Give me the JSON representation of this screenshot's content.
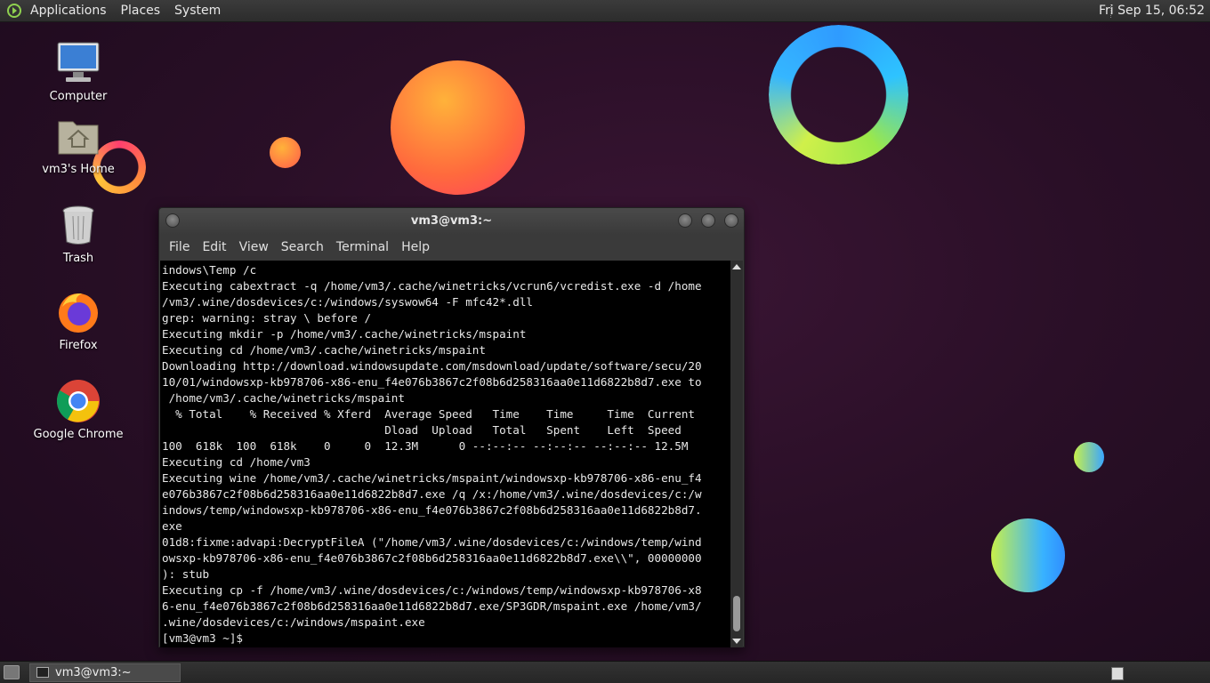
{
  "top_panel": {
    "menus": [
      "Applications",
      "Places",
      "System"
    ],
    "clock": "Fri Sep 15, 06:52"
  },
  "desktop_icons": [
    {
      "label": "Computer",
      "icon": "computer-icon"
    },
    {
      "label": "vm3's Home",
      "icon": "home-folder-icon"
    },
    {
      "label": "Trash",
      "icon": "trash-icon"
    },
    {
      "label": "Firefox",
      "icon": "firefox-icon"
    },
    {
      "label": "Google Chrome",
      "icon": "chrome-icon"
    }
  ],
  "window": {
    "title": "vm3@vm3:~",
    "menu": [
      "File",
      "Edit",
      "View",
      "Search",
      "Terminal",
      "Help"
    ],
    "lines": [
      "indows\\Temp /c",
      "Executing cabextract -q /home/vm3/.cache/winetricks/vcrun6/vcredist.exe -d /home",
      "/vm3/.wine/dosdevices/c:/windows/syswow64 -F mfc42*.dll",
      "grep: warning: stray \\ before /",
      "Executing mkdir -p /home/vm3/.cache/winetricks/mspaint",
      "Executing cd /home/vm3/.cache/winetricks/mspaint",
      "Downloading http://download.windowsupdate.com/msdownload/update/software/secu/20",
      "10/01/windowsxp-kb978706-x86-enu_f4e076b3867c2f08b6d258316aa0e11d6822b8d7.exe to",
      " /home/vm3/.cache/winetricks/mspaint",
      "  % Total    % Received % Xferd  Average Speed   Time    Time     Time  Current",
      "                                 Dload  Upload   Total   Spent    Left  Speed",
      "100  618k  100  618k    0     0  12.3M      0 --:--:-- --:--:-- --:--:-- 12.5M",
      "Executing cd /home/vm3",
      "Executing wine /home/vm3/.cache/winetricks/mspaint/windowsxp-kb978706-x86-enu_f4",
      "e076b3867c2f08b6d258316aa0e11d6822b8d7.exe /q /x:/home/vm3/.wine/dosdevices/c:/w",
      "indows/temp/windowsxp-kb978706-x86-enu_f4e076b3867c2f08b6d258316aa0e11d6822b8d7.",
      "exe",
      "01d8:fixme:advapi:DecryptFileA (\"/home/vm3/.wine/dosdevices/c:/windows/temp/wind",
      "owsxp-kb978706-x86-enu_f4e076b3867c2f08b6d258316aa0e11d6822b8d7.exe\\\\\", 00000000",
      "): stub",
      "Executing cp -f /home/vm3/.wine/dosdevices/c:/windows/temp/windowsxp-kb978706-x8",
      "6-enu_f4e076b3867c2f08b6d258316aa0e11d6822b8d7.exe/SP3GDR/mspaint.exe /home/vm3/",
      ".wine/dosdevices/c:/windows/mspaint.exe",
      "[vm3@vm3 ~]$ "
    ]
  },
  "taskbar": {
    "task_label": "vm3@vm3:~"
  }
}
